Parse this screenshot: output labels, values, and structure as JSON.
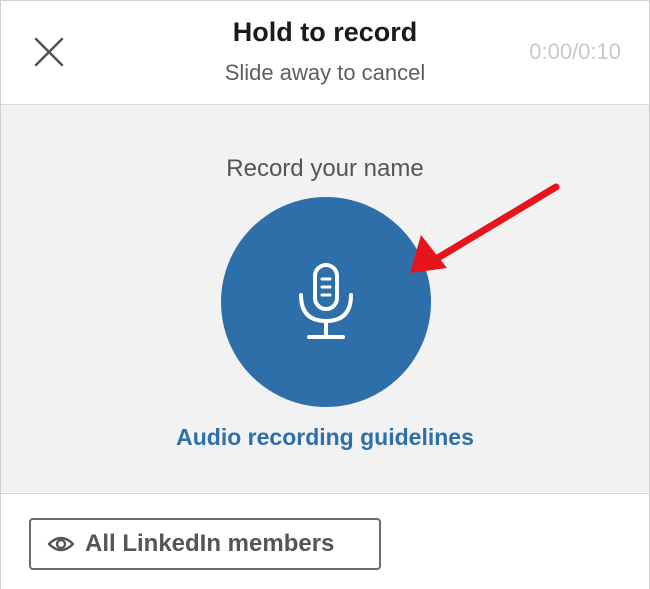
{
  "header": {
    "title": "Hold to record",
    "subtitle": "Slide away to cancel",
    "timer": "0:00/0:10",
    "close_icon": "close-icon"
  },
  "recorder": {
    "label": "Record your name",
    "button_icon": "microphone-icon",
    "guidelines_link": "Audio recording guidelines",
    "accent_color": "#2f6fa9",
    "annotation": "red-arrow"
  },
  "footer": {
    "visibility_icon": "eye-icon",
    "visibility_label": "All LinkedIn members"
  }
}
